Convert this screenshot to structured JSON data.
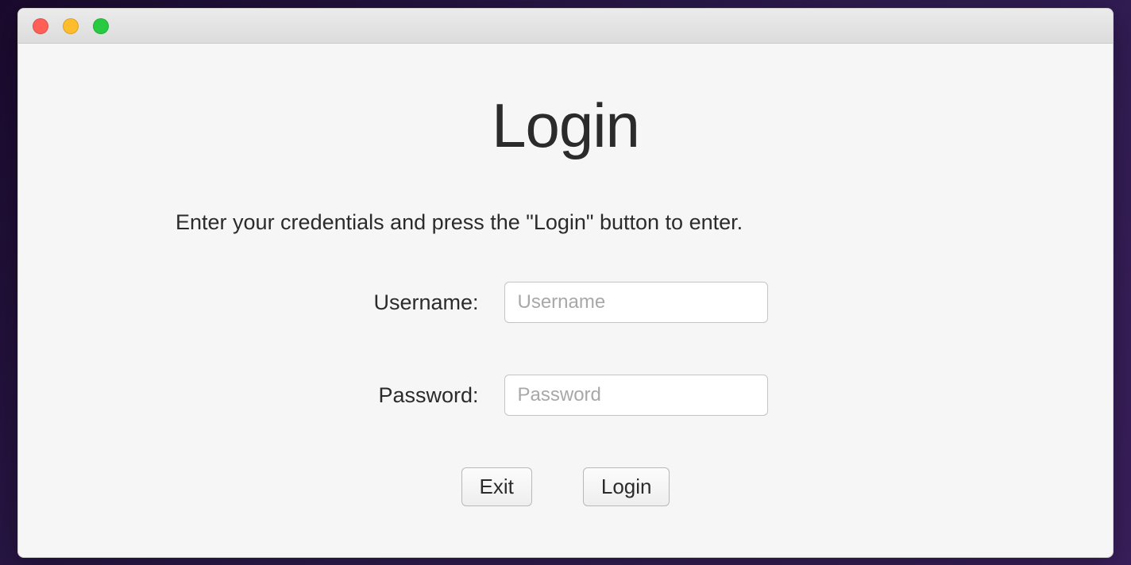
{
  "header": {
    "title": "Login"
  },
  "instruction": "Enter your credentials and press the \"Login\" button to enter.",
  "form": {
    "username": {
      "label": "Username:",
      "placeholder": "Username",
      "value": ""
    },
    "password": {
      "label": "Password:",
      "placeholder": "Password",
      "value": ""
    }
  },
  "buttons": {
    "exit": "Exit",
    "login": "Login"
  }
}
